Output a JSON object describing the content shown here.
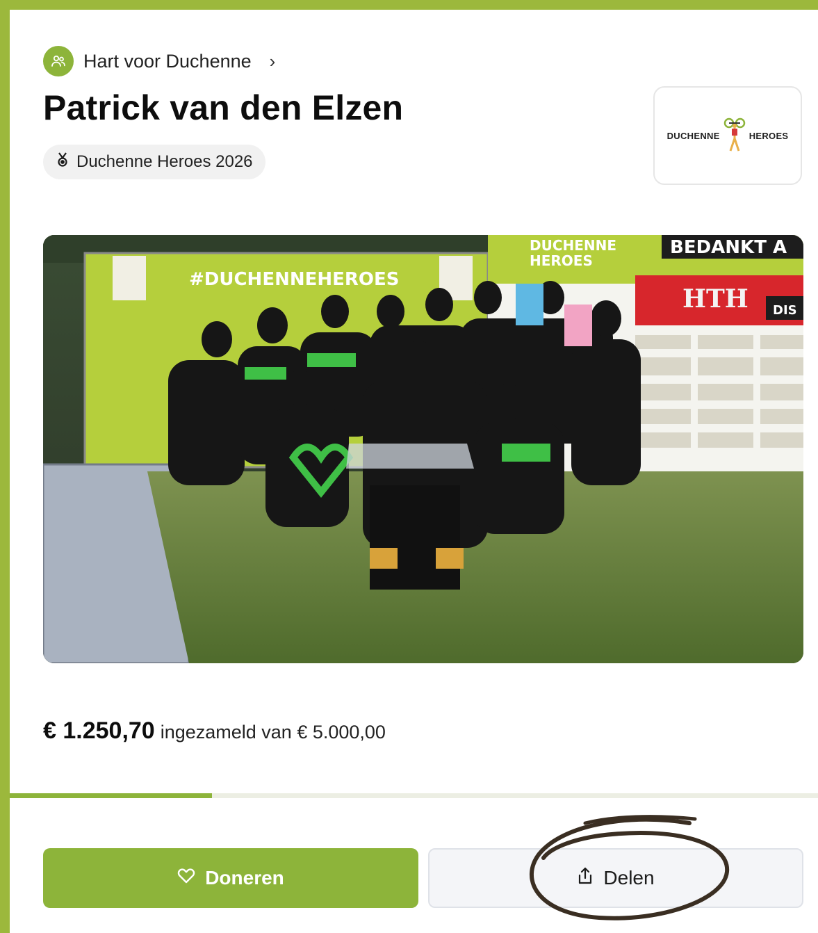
{
  "header": {
    "org_name": "Hart voor Duchenne",
    "org_icon": "people-icon",
    "title": "Patrick van den Elzen",
    "event_label": "Duchenne Heroes 2026",
    "event_icon": "medal-icon"
  },
  "logo": {
    "left_text": "DUCHENNE",
    "right_text": "HEROES"
  },
  "photo": {
    "banner_left": "#DUCHENNEHEROES",
    "banner_right_top": "DUCHENNE",
    "banner_right_bottom": "HEROES",
    "banner_thanks": "BEDANKT A",
    "sponsor_brand": "HTH",
    "sponsor_dis": "DIS"
  },
  "fundraising": {
    "raised": "€ 1.250,70",
    "suffix": "ingezameld van € 5.000,00",
    "progress_percent": 25
  },
  "actions": {
    "donate_label": "Doneren",
    "share_label": "Delen"
  },
  "colors": {
    "brand_green": "#8db43a",
    "frame_green": "#9cb83c"
  }
}
